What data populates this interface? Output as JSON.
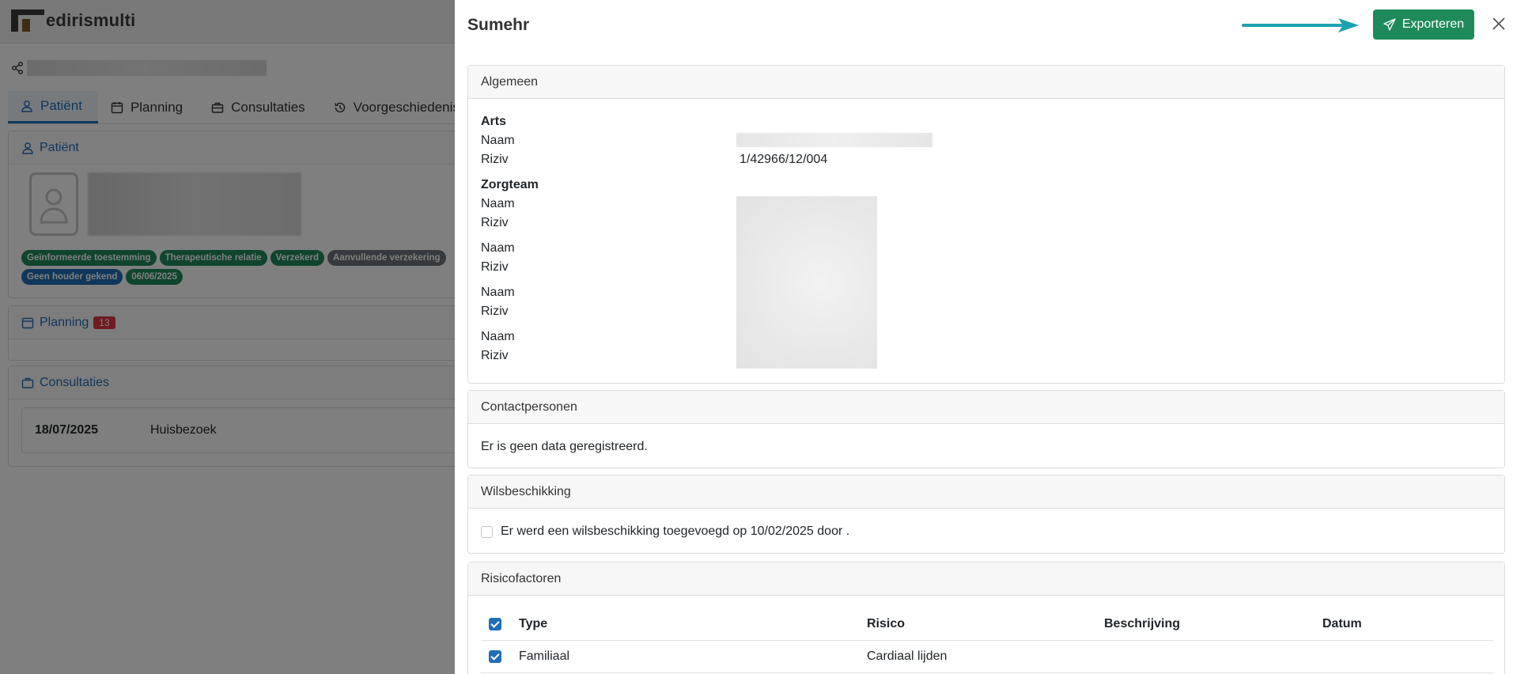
{
  "app": {
    "logo_main": "edirismulti",
    "tabs": [
      {
        "label": "Patiënt",
        "icon": "person-icon"
      },
      {
        "label": "Planning",
        "icon": "calendar-icon"
      },
      {
        "label": "Consultaties",
        "icon": "briefcase-icon"
      },
      {
        "label": "Voorgeschiedenis",
        "icon": "history-icon"
      }
    ],
    "patient_panel": {
      "title": "Patiënt",
      "badges_row1": [
        "Geïnformeerde toestemming",
        "Therapeutische relatie",
        "Verzekerd",
        "Aanvullende verzekering"
      ],
      "badges_row2": [
        "Geen houder gekend",
        "06/06/2025"
      ]
    },
    "planning_panel": {
      "title": "Planning",
      "count": "13"
    },
    "consult_panel": {
      "title": "Consultaties",
      "item": {
        "date": "18/07/2025",
        "type": "Huisbezoek"
      }
    }
  },
  "drawer": {
    "title": "Sumehr",
    "export_label": "Exporteren",
    "sections": {
      "algemeen": {
        "title": "Algemeen",
        "arts_heading": "Arts",
        "naam_label": "Naam",
        "riziv_label": "Riziv",
        "arts_riziv": "1/42966/12/004",
        "zorgteam_heading": "Zorgteam",
        "zorgteam_rows": [
          {
            "naam": "Naam",
            "riziv": "Riziv"
          },
          {
            "naam": "Naam",
            "riziv": "Riziv"
          },
          {
            "naam": "Naam",
            "riziv": "Riziv"
          },
          {
            "naam": "Naam",
            "riziv": "Riziv"
          }
        ]
      },
      "contactpersonen": {
        "title": "Contactpersonen",
        "empty": "Er is geen data geregistreerd."
      },
      "wilsbeschikking": {
        "title": "Wilsbeschikking",
        "text": "Er werd een wilsbeschikking toegevoegd op 10/02/2025 door ."
      },
      "risicofactoren": {
        "title": "Risicofactoren",
        "columns": [
          "Type",
          "Risico",
          "Beschrijving",
          "Datum"
        ],
        "rows": [
          {
            "type": "Familiaal",
            "risico": "Cardiaal lijden",
            "beschrijving": "",
            "datum": ""
          }
        ]
      }
    }
  },
  "colors": {
    "primary": "#1f6fb8",
    "success": "#1e8a5a",
    "danger": "#dc3545",
    "arrow": "#1aa3b0"
  }
}
